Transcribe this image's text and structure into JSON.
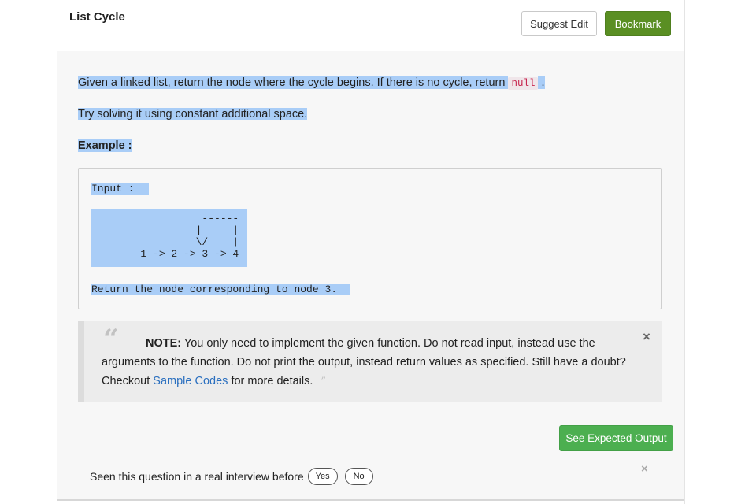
{
  "header": {
    "title": "List Cycle",
    "suggest_edit_label": "Suggest Edit",
    "bookmark_label": "Bookmark"
  },
  "problem": {
    "line1_pre": "Given a linked list, return the node where the cycle begins. If there is no cycle, return",
    "line1_code": "null",
    "line1_post": ".",
    "line2": "Try solving it using constant additional space.",
    "example_heading": "Example :"
  },
  "example": {
    "input_label": "Input :",
    "diagram": "                  ------\n                 |     |\n                 \\/    |\n        1 -> 2 -> 3 -> 4",
    "return_text": "Return the node corresponding to node 3."
  },
  "note": {
    "open_quote": "“",
    "close_quote": "”",
    "label": "NOTE:",
    "text_before_link": "You only need to implement the given function. Do not read input, instead use the arguments to the function. Do not print the output, instead return values as specified. Still have a doubt? Checkout",
    "link_text": "Sample Codes",
    "text_after_link": "for more details.",
    "close_icon": "×"
  },
  "actions": {
    "see_expected_output_label": "See Expected Output"
  },
  "interview": {
    "question": "Seen this question in a real interview before",
    "yes_label": "Yes",
    "no_label": "No",
    "close_icon": "×"
  },
  "colors": {
    "bookmark_green": "#5a8f23",
    "expected_output_green": "#4caf50",
    "selection_blue": "#a9cdf7",
    "link_blue": "#2a6fbf",
    "inline_code_red": "#c7254e"
  }
}
